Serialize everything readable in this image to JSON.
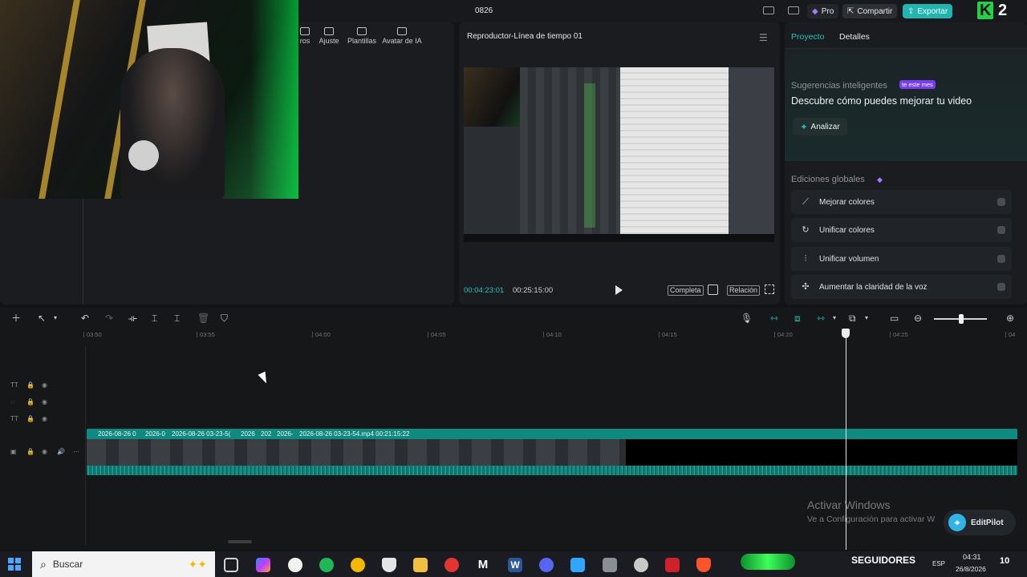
{
  "window": {
    "title": "0826",
    "pro_label": "Pro",
    "share_label": "Compartir",
    "export_label": "Exportar",
    "brand_logo": "K 2"
  },
  "media_panel": {
    "tabs": [
      {
        "label": "ros",
        "icon": "media-icon"
      },
      {
        "label": "Ajuste",
        "icon": "sliders-icon"
      },
      {
        "label": "Plantillas",
        "icon": "templates-icon"
      },
      {
        "label": "Avatar de IA",
        "icon": "ai-avatar-icon"
      }
    ]
  },
  "player": {
    "title": "Reproductor-Línea de tiempo 01",
    "current_time": "00:04:23:01",
    "total_time": "00:25:15:00",
    "full_label": "Completa",
    "ratio_label": "Relación"
  },
  "right_panel": {
    "tabs": [
      "Proyecto",
      "Detalles"
    ],
    "smart_label": "Sugerencias inteligentes",
    "smart_badge": "te este mes",
    "smart_headline": "Descubre cómo puedes mejorar tu video",
    "analyze_label": "Analizar",
    "global_label": "Ediciones globales",
    "edits": [
      {
        "label": "Mejorar colores",
        "icon": "magic-wand-icon"
      },
      {
        "label": "Unificar colores",
        "icon": "color-match-icon"
      },
      {
        "label": "Unificar volumen",
        "icon": "volume-bars-icon"
      },
      {
        "label": "Aumentar la claridad de la voz",
        "icon": "voice-icon"
      }
    ]
  },
  "timeline": {
    "ticks": [
      "03:50",
      "03:55",
      "04:00",
      "04:05",
      "04:10",
      "04:15",
      "04:20",
      "04:25",
      "04"
    ],
    "clips": [
      {
        "label": "2026-08-26 0"
      },
      {
        "label": "2026-0"
      },
      {
        "label": "2026-08-26 03-23-5("
      },
      {
        "label": "2026"
      },
      {
        "label": "202"
      },
      {
        "label": "2026-"
      },
      {
        "label": "2026-08-26 03-23-54.mp4   00:21:15:22"
      }
    ]
  },
  "watermark": {
    "title": "Activar Windows",
    "subtitle": "Ve a Configuración para activar W"
  },
  "editpilot_label": "EditPilot",
  "taskbar": {
    "search_placeholder": "Buscar",
    "followers_label": "SEGUIDORES",
    "lang": "ESP",
    "time": "04:31",
    "date": "26/8/2026",
    "notifications": "10"
  },
  "colors": {
    "accent": "#21c3b6",
    "export": "#1fb5b0",
    "badge": "#7a3cf0"
  }
}
